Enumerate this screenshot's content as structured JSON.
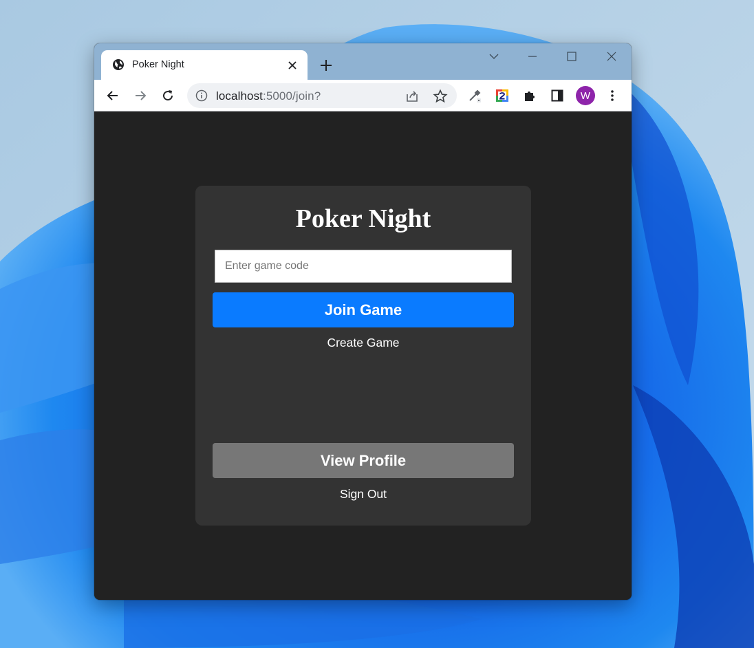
{
  "browser": {
    "tab": {
      "title": "Poker Night",
      "favicon": "globe-icon"
    },
    "address_bar": {
      "host": "localhost",
      "path": ":5000/join?"
    },
    "extensions": [
      "eyedropper-icon",
      "extension-2-icon",
      "puzzle-icon",
      "sidepanel-icon"
    ],
    "profile_avatar": {
      "initial": "W",
      "color": "#8e24aa"
    }
  },
  "page": {
    "title": "Poker Night",
    "game_code_input": {
      "placeholder": "Enter game code",
      "value": ""
    },
    "join_button_label": "Join Game",
    "create_link_label": "Create Game",
    "profile_button_label": "View Profile",
    "signout_link_label": "Sign Out"
  },
  "colors": {
    "page_bg": "#222222",
    "card_bg": "#333333",
    "primary_button": "#0a7bff",
    "secondary_button": "#777777"
  }
}
